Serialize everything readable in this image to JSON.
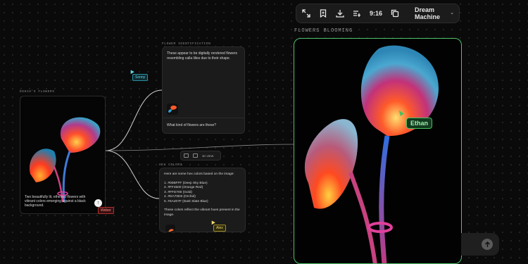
{
  "canvas": {
    "image_node": {
      "label": "EDKAH'S FLOWERS",
      "caption": "Two beautifully lit, ethereal flowers with vibrant colors emerging against a black background."
    },
    "identification_node": {
      "label": "FLOWER IDENTIFICATION",
      "answer": "These appear to be digitally rendered flowers resembling calla lilies due to their shape.",
      "question": "What kind of flowers are these?"
    },
    "hex_node": {
      "label": "HEX COLORS",
      "intro": "Here are some hex colors based on the image:",
      "colors": [
        "1. #00BFFF (Deep Sky Blue)",
        "2. #FF4500 (Orange Red)",
        "3. #FFD700 (Gold)",
        "4. #DA70D6 (Orchid)",
        "5. #4A207F (Dark Slate Blue)"
      ],
      "outro": "These colors reflect the vibrant hues present in the image."
    },
    "mini_toolbar": {
      "label": "3D VIEW"
    },
    "collaborators": [
      {
        "name": "Sonny",
        "color": "#5fd6e8"
      },
      {
        "name": "Weber",
        "color": "#ff8a8a"
      },
      {
        "name": "Alex",
        "color": "#f2d76a"
      },
      {
        "name": "Ethan",
        "color": "#46c063"
      }
    ]
  },
  "toolbar": {
    "icons": [
      "expand-icon",
      "bookmark-icon",
      "download-icon",
      "add-list-icon",
      "copy-icon"
    ],
    "time": "9:16",
    "model": "Dream Machine"
  },
  "preview": {
    "title": "FLOWERS BLOOMING",
    "frame_color": "#4ec26a"
  },
  "input": {
    "send_icon": "arrow-up-icon"
  }
}
